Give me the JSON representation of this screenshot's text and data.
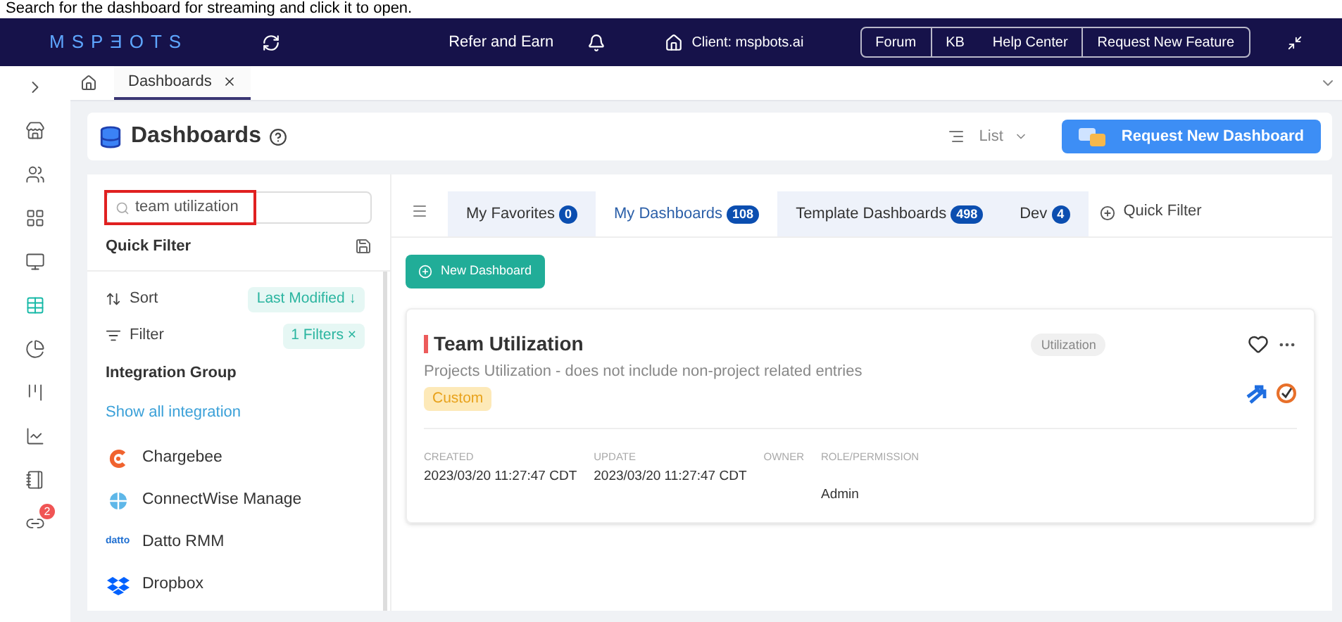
{
  "caption": "Search for the dashboard for streaming and click it to open.",
  "header": {
    "logo": "MSPƎOTS",
    "refer": "Refer and Earn",
    "client": "Client: mspbots.ai",
    "links": [
      "Forum",
      "KB",
      "Help Center",
      "Request New Feature"
    ]
  },
  "rail": [
    {
      "kind": "expand",
      "selected": false
    },
    {
      "kind": "store",
      "selected": false
    },
    {
      "kind": "users",
      "selected": false
    },
    {
      "kind": "grid",
      "selected": false
    },
    {
      "kind": "monitor",
      "selected": false
    },
    {
      "kind": "table",
      "selected": true
    },
    {
      "kind": "pie",
      "selected": false
    },
    {
      "kind": "kanban",
      "selected": false
    },
    {
      "kind": "chart",
      "selected": false
    },
    {
      "kind": "notebook",
      "selected": false
    },
    {
      "kind": "link",
      "selected": false,
      "badge": "2"
    }
  ],
  "tabs": [
    {
      "label": "Dashboards",
      "selected": true
    }
  ],
  "page": {
    "title": "Dashboards",
    "view": "List",
    "request_button": "Request New Dashboard"
  },
  "filter_panel": {
    "search": {
      "value": "team utilization"
    },
    "title": "Quick Filter",
    "sort": {
      "label": "Sort",
      "value": "Last Modified ↓"
    },
    "filter": {
      "label": "Filter",
      "value": "1 Filters ×"
    },
    "group_title": "Integration Group",
    "show_all": "Show all integration",
    "integrations": [
      {
        "kind": "chargebee",
        "name": "Chargebee"
      },
      {
        "kind": "connectwise",
        "name": "ConnectWise Manage"
      },
      {
        "kind": "datto",
        "name": "Datto RMM",
        "logo": "datto"
      },
      {
        "kind": "dropbox",
        "name": "Dropbox"
      }
    ]
  },
  "dashboard_tabs": [
    {
      "label": "My Favorites",
      "count": "0",
      "selected": false
    },
    {
      "label": "My Dashboards",
      "count": "108",
      "selected": true
    },
    {
      "label": "Template Dashboards",
      "count": "498",
      "selected": false
    },
    {
      "label": "Dev",
      "count": "4",
      "selected": false
    }
  ],
  "quick_filter": "Quick Filter",
  "new_button": "New Dashboard",
  "card": {
    "title": "Team Utilization",
    "tag": "Utilization",
    "description": "Projects Utilization - does not include non-project related entries",
    "badge": "Custom",
    "favorite": false,
    "fields": [
      {
        "kind": "date",
        "label": "CREATED",
        "value": "2023/03/20 11:27:47 CDT"
      },
      {
        "kind": "date",
        "label": "UPDATE",
        "value": "2023/03/20 11:27:47 CDT"
      },
      {
        "kind": "owner",
        "label": "OWNER"
      },
      {
        "kind": "role",
        "label": "ROLE/PERMISSION",
        "value": "Admin"
      }
    ]
  }
}
